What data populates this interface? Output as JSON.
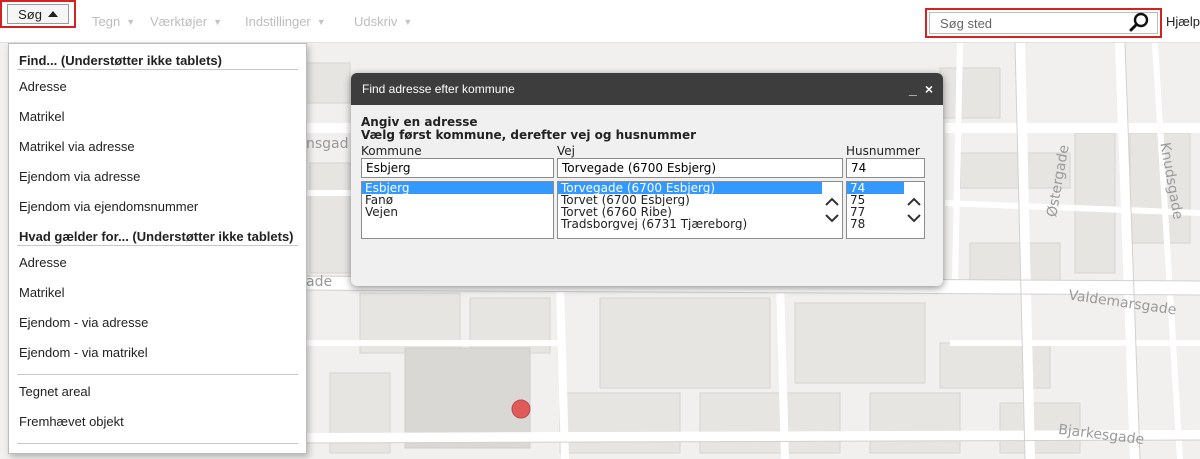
{
  "toolbar": {
    "soeg_label": "Søg",
    "menus": [
      "Tegn",
      "Værktøjer",
      "Indstillinger",
      "Udskriv"
    ],
    "search_placeholder": "Søg sted",
    "help_label": "Hjælp"
  },
  "dropdown": {
    "section1_header": "Find... (Understøtter ikke tablets)",
    "section1_items": [
      "Adresse",
      "Matrikel",
      "Matrikel via adresse",
      "Ejendom via adresse",
      "Ejendom via ejendomsnummer"
    ],
    "section2_header": "Hvad gælder for... (Understøtter ikke tablets)",
    "section2_items": [
      "Adresse",
      "Matrikel",
      "Ejendom - via adresse",
      "Ejendom - via matrikel"
    ],
    "section3_items": [
      "Tegnet areal",
      "Fremhævet objekt"
    ]
  },
  "dialog": {
    "title": "Find adresse efter kommune",
    "minimize_label": "_",
    "close_label": "×",
    "heading_line1": "Angiv en adresse",
    "heading_line2": "Vælg først kommune, derefter vej og husnummer",
    "kommune": {
      "label": "Kommune",
      "value": "Esbjerg",
      "options": [
        "Esbjerg",
        "Fanø",
        "Vejen"
      ],
      "selected": "Esbjerg"
    },
    "vej": {
      "label": "Vej",
      "value": "Torvegade (6700 Esbjerg)",
      "options": [
        "Torvegade (6700 Esbjerg)",
        "Torvet (6700 Esbjerg)",
        "Torvet (6760 Ribe)",
        "Tradsborgvej (6731 Tjæreborg)"
      ],
      "selected": "Torvegade (6700 Esbjerg)"
    },
    "husnummer": {
      "label": "Husnummer",
      "value": "74",
      "options": [
        "74",
        "75",
        "77",
        "78"
      ],
      "selected": "74"
    }
  },
  "map": {
    "street_labels": [
      "Valdemarsgade",
      "Bjarkesgade",
      "Østergade",
      "Knudsgade",
      "nsgad",
      "ade"
    ]
  },
  "colors": {
    "highlight_red": "#d32222",
    "dialog_title_bg": "#3d3d3d",
    "selection_blue": "#3399ff",
    "marker": "#e05a5a"
  },
  "icons": {
    "search": "magnifier-icon",
    "caret": "caret-down-icon",
    "soeg_caret": "caret-up-icon"
  }
}
